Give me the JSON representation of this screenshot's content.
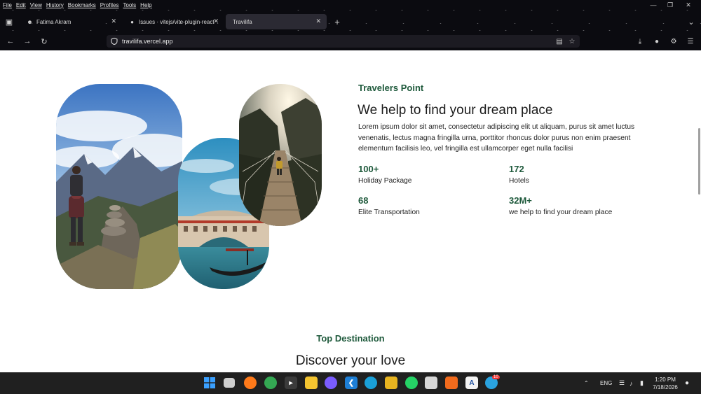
{
  "browser": {
    "menu": [
      "File",
      "Edit",
      "View",
      "History",
      "Bookmarks",
      "Profiles",
      "Tools",
      "Help"
    ],
    "tabs": [
      {
        "label": "Fatima Akram",
        "icon": "user-icon"
      },
      {
        "label": "Issues · vitejs/vite-plugin-react",
        "icon": "github-icon"
      },
      {
        "label": "Travilifa",
        "icon": "page-icon"
      }
    ],
    "url": "travilifa.vercel.app"
  },
  "about": {
    "eyebrow": "Travelers Point",
    "heading": "We help to find your dream place",
    "paragraph": "Lorem ipsum dolor sit amet, consectetur adipiscing elit ut aliquam, purus sit amet luctus venenatis, lectus magna fringilla urna, porttitor rhoncus dolor purus non enim praesent elementum facilisis leo, vel fringilla est ullamcorper eget nulla facilisi",
    "stats": [
      {
        "value": "100+",
        "label": "Holiday Package"
      },
      {
        "value": "172",
        "label": "Hotels"
      },
      {
        "value": "68",
        "label": "Elite Transportation"
      },
      {
        "value": "32M+",
        "label": "we help to find your dream place"
      }
    ]
  },
  "destination": {
    "eyebrow": "Top Destination",
    "heading": "Discover your love"
  },
  "taskbar": {
    "lang": "ENG",
    "time": "1:20 PM",
    "date": "7/18/2026",
    "badge": "10"
  },
  "colors": {
    "accent_green": "#1f5a3c",
    "chrome_bg": "#0b0b10",
    "taskbar_bg": "#202020"
  }
}
